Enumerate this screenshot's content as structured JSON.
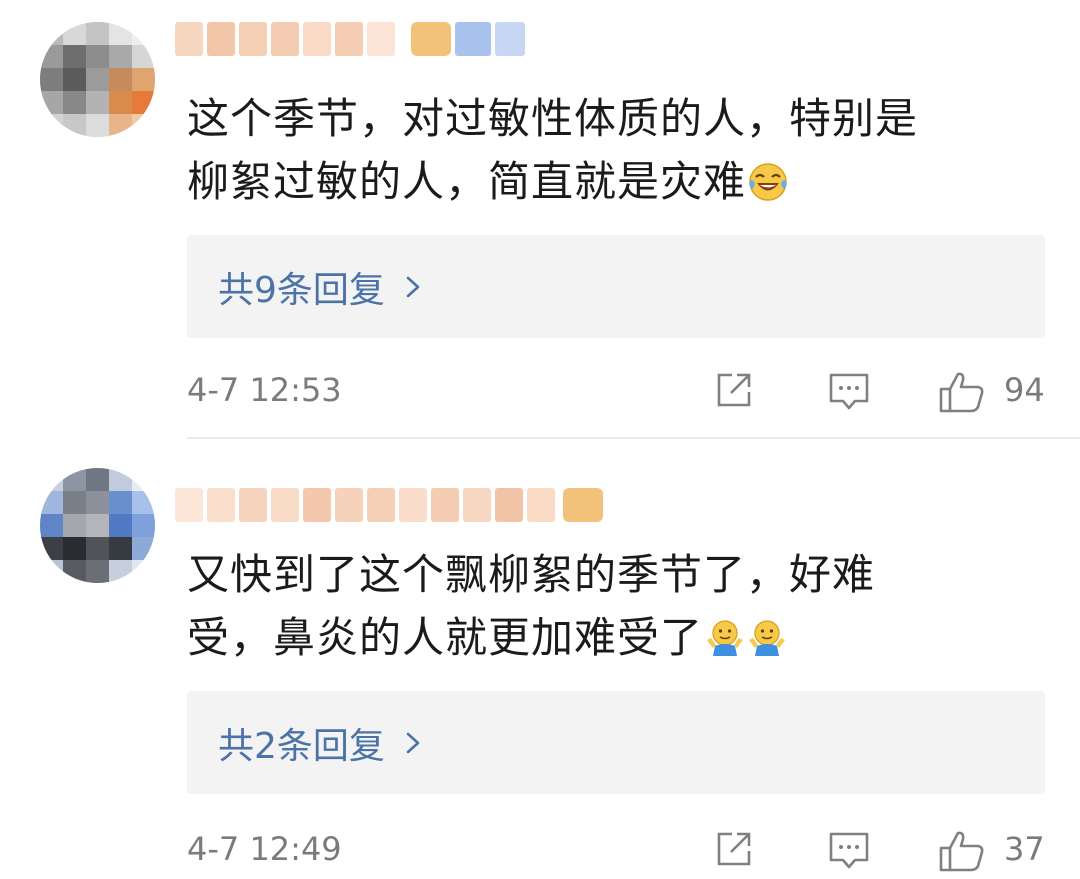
{
  "comments": [
    {
      "text_line1": "这个季节，对过敏性体质的人，特别是",
      "text_line2": "柳絮过敏的人，简直就是灾难",
      "emoji": "laughing-tears-emoji",
      "replies_label": "共9条回复",
      "time": "4-7 12:53",
      "likes": "94"
    },
    {
      "text_line1": "又快到了这个飘柳絮的季节了，好难",
      "text_line2": "受，鼻炎的人就更加难受了",
      "emoji": "shrug-emoji",
      "replies_label": "共2条回复",
      "time": "4-7 12:49",
      "likes": "37"
    }
  ],
  "colors": {
    "link": "#4c73a8",
    "meta_text": "#7b7b7b",
    "reply_bg": "#f3f3f3",
    "body_text": "#1b1b1b"
  },
  "icons": [
    "share-icon",
    "comment-icon",
    "like-icon",
    "chevron-right-icon"
  ]
}
